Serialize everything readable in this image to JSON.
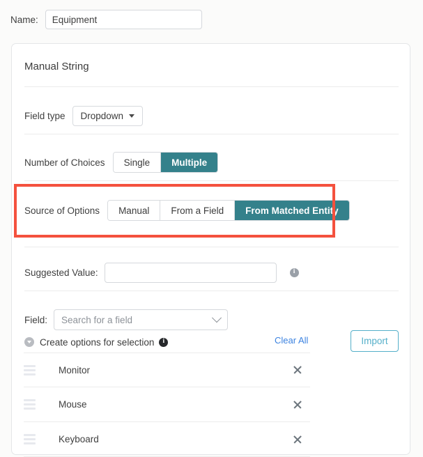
{
  "name_field": {
    "label": "Name:",
    "value": "Equipment",
    "placeholder": ""
  },
  "card": {
    "title": "Manual String",
    "field_type": {
      "label": "Field type",
      "value": "Dropdown",
      "caret_icon": "caret-down-icon"
    },
    "number_of_choices": {
      "label": "Number of Choices",
      "options": [
        "Single",
        "Multiple"
      ],
      "selected": "Multiple"
    },
    "source_of_options": {
      "label": "Source of Options",
      "options": [
        "Manual",
        "From a Field",
        "From Matched Entity"
      ],
      "selected": "From Matched Entity"
    },
    "suggested_value": {
      "label": "Suggested Value:",
      "value": "",
      "placeholder": "",
      "info_icon": "info-icon"
    },
    "field_search": {
      "label": "Field:",
      "placeholder": "Search for a field",
      "value": "",
      "chevron_icon": "chevron-down-icon"
    },
    "create_options": {
      "label": "Create options for selection",
      "collapse_icon": "collapse-circle-icon",
      "info_icon": "info-icon",
      "clear_all_label": "Clear All",
      "import_label": "Import"
    },
    "options_list": [
      {
        "label": "Monitor",
        "drag_icon": "drag-handle-icon",
        "remove_icon": "close-icon"
      },
      {
        "label": "Mouse",
        "drag_icon": "drag-handle-icon",
        "remove_icon": "close-icon"
      },
      {
        "label": "Keyboard",
        "drag_icon": "drag-handle-icon",
        "remove_icon": "close-icon"
      }
    ]
  },
  "annotation": {
    "highlight_color": "#f4513e",
    "target": "source-of-options-row"
  },
  "colors": {
    "accent_teal": "#34818b",
    "link_blue": "#3b82e0",
    "import_blue": "#54afc9",
    "highlight_red": "#f4513e"
  }
}
